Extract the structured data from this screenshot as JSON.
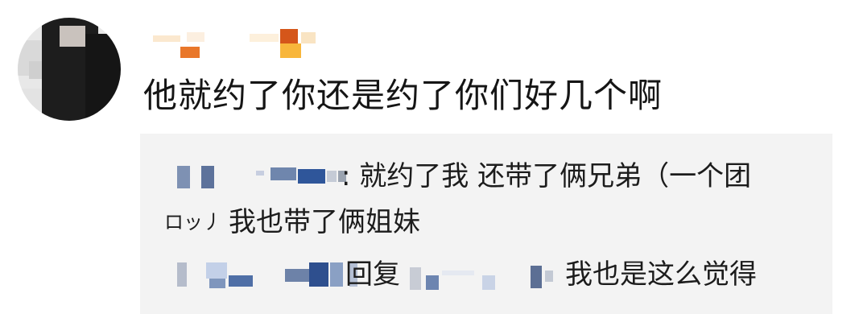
{
  "comment": {
    "text": "他就约了你还是约了你们好几个啊"
  },
  "replies": [
    {
      "text": ": 就约了我 还带了俩兄弟（一个团"
    },
    {
      "fragment": "ロッ丿",
      "text": "我也带了俩姐妹"
    },
    {
      "reply_label": "回复",
      "text": "我也是这么觉得"
    }
  ],
  "colors": {
    "reply_background": "#f3f3f3",
    "text": "#1c1c1c"
  }
}
